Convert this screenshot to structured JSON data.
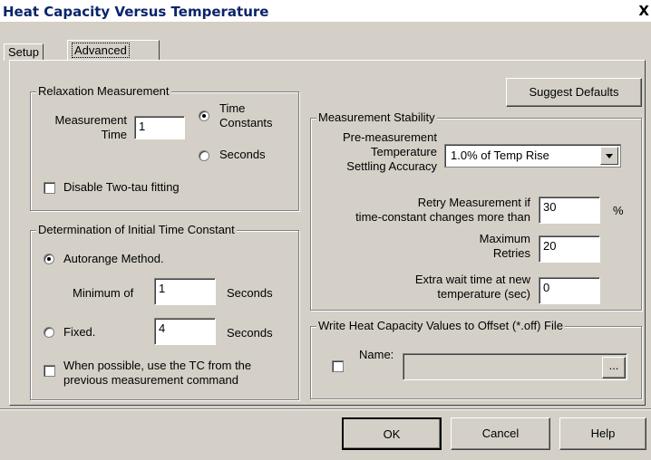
{
  "window": {
    "title": "Heat Capacity Versus Temperature",
    "close_label": "X"
  },
  "tabs": [
    {
      "label": "Setup"
    },
    {
      "label": "Advanced",
      "active": true
    }
  ],
  "relaxation": {
    "legend": "Relaxation Measurement",
    "time_label_1": "Measurement",
    "time_label_2": "Time",
    "time_value": "1",
    "radio_time_constants_1": "Time",
    "radio_time_constants_2": "Constants",
    "radio_time_constants_selected": true,
    "radio_seconds": "Seconds",
    "disable_two_tau": "Disable Two-tau fitting",
    "disable_two_tau_checked": false
  },
  "initial_tc": {
    "legend": "Determination of Initial Time Constant",
    "autorange_label": "Autorange Method.",
    "autorange_selected": true,
    "minimum_label": "Minimum of",
    "minimum_value": "1",
    "minimum_unit": "Seconds",
    "fixed_label": "Fixed.",
    "fixed_value": "4",
    "fixed_unit": "Seconds",
    "use_prev_line1": "When possible, use the TC from the",
    "use_prev_line2": "previous measurement command",
    "use_prev_checked": false
  },
  "suggest_defaults_label": "Suggest Defaults",
  "stability": {
    "legend": "Measurement Stability",
    "premeasure_line1": "Pre-measurement",
    "premeasure_line2": "Temperature",
    "premeasure_line3": "Settling Accuracy",
    "accuracy_selected": "1.0% of Temp Rise",
    "retry_line1": "Retry Measurement if",
    "retry_line2": "time-constant changes more than",
    "retry_value": "30",
    "retry_unit": "%",
    "max_retries_line1": "Maximum",
    "max_retries_line2": "Retries",
    "max_retries_value": "20",
    "extra_wait_line1": "Extra wait time at new",
    "extra_wait_line2": "temperature (sec)",
    "extra_wait_value": "0"
  },
  "offset_file": {
    "legend": "Write Heat Capacity Values to Offset (*.off) File",
    "name_label": "Name:",
    "name_value": "",
    "enabled_checked": false,
    "browse_label": "..."
  },
  "buttons": {
    "ok": "OK",
    "cancel": "Cancel",
    "help": "Help"
  },
  "icons": {
    "close": "close-icon",
    "dropdown": "chevron-down-icon"
  }
}
